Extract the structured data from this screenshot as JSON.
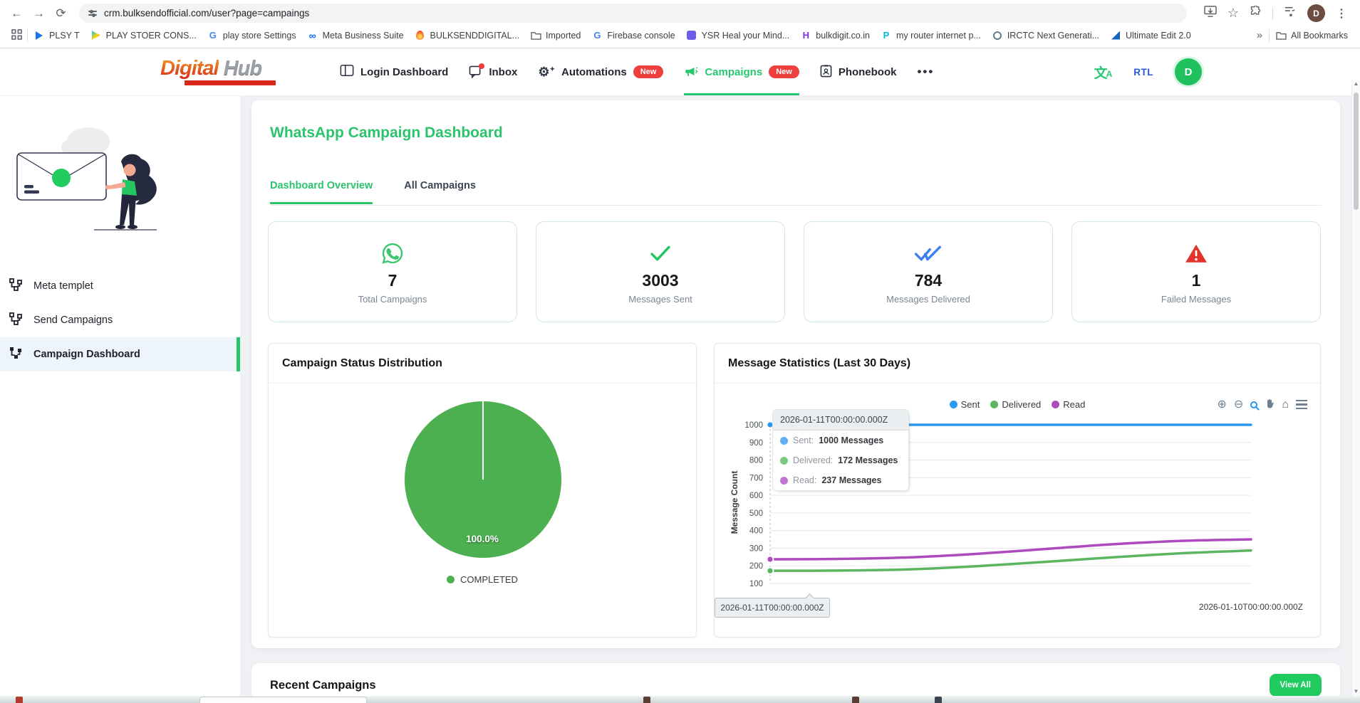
{
  "browser": {
    "url": "crm.bulksendofficial.com/user?page=campaings",
    "profile_initial": "D",
    "bookmarks": [
      {
        "label": "PLSY T",
        "icon": "play-blue"
      },
      {
        "label": "PLAY STOER CONS...",
        "icon": "play-color"
      },
      {
        "label": "play store Settings",
        "icon": "google-g"
      },
      {
        "label": "Meta Business Suite",
        "icon": "meta-infinity"
      },
      {
        "label": "BULKSENDDIGITAL...",
        "icon": "orange-flame"
      },
      {
        "label": "Imported",
        "icon": "folder"
      },
      {
        "label": "Firebase console",
        "icon": "google-g"
      },
      {
        "label": "YSR Heal your Mind...",
        "icon": "purple-app"
      },
      {
        "label": "bulkdigit.co.in",
        "icon": "purple-h"
      },
      {
        "label": "my router internet p...",
        "icon": "teal-p"
      },
      {
        "label": "IRCTC Next Generati...",
        "icon": "irctc-logo"
      },
      {
        "label": "Ultimate Edit 2.0",
        "icon": "blue-sail"
      }
    ],
    "overflow_chevron": "»",
    "all_bookmarks": "All Bookmarks"
  },
  "header": {
    "logo": {
      "word1": "Digital",
      "word2": "Hub"
    },
    "nav": [
      {
        "label": "Login Dashboard"
      },
      {
        "label": "Inbox"
      },
      {
        "label": "Automations",
        "badge": "New"
      },
      {
        "label": "Campaigns",
        "badge": "New"
      },
      {
        "label": "Phonebook"
      }
    ],
    "rtl_label": "RTL",
    "avatar_initial": "D",
    "accent_color": "#28c76f",
    "badge_color": "#ee3e3e"
  },
  "sidebar": {
    "items": [
      {
        "label": "Meta templet"
      },
      {
        "label": "Send Campaigns"
      },
      {
        "label": "Campaign Dashboard"
      }
    ]
  },
  "main": {
    "title": "WhatsApp Campaign Dashboard",
    "tabs": [
      {
        "label": "Dashboard Overview"
      },
      {
        "label": "All Campaigns"
      }
    ],
    "stats": [
      {
        "value": "7",
        "label": "Total Campaigns",
        "icon": "whatsapp",
        "color": "#38c76c"
      },
      {
        "value": "3003",
        "label": "Messages Sent",
        "icon": "check",
        "color": "#22c55e"
      },
      {
        "value": "784",
        "label": "Messages Delivered",
        "icon": "double-check",
        "color": "#3d7ff0"
      },
      {
        "value": "1",
        "label": "Failed Messages",
        "icon": "warning",
        "color": "#e2342c"
      }
    ],
    "recent": {
      "title": "Recent Campaigns",
      "view_all": "View All"
    }
  },
  "chart_data": [
    {
      "type": "pie",
      "title": "Campaign Status Distribution",
      "categories": [
        "COMPLETED"
      ],
      "values": [
        100.0
      ],
      "data_label": "100.0%",
      "colors": [
        "#4caf50"
      ],
      "legend_position": "bottom"
    },
    {
      "type": "line",
      "title": "Message Statistics (Last 30 Days)",
      "ylabel": "Message Count",
      "ylim": [
        100,
        1000
      ],
      "yticks": [
        100,
        200,
        300,
        400,
        500,
        600,
        700,
        800,
        900,
        1000
      ],
      "grid": true,
      "legend_position": "top",
      "x_axis_labels": [
        "2026-01-11T00:00:00.000Z",
        "2026-01-10T00:00:00.000Z"
      ],
      "x": [
        0,
        0.14,
        0.29,
        0.43,
        0.57,
        0.71,
        0.86,
        1
      ],
      "series": [
        {
          "name": "Sent",
          "color": "#2b98f0",
          "values": [
            1000,
            1000,
            1000,
            1000,
            1000,
            1000,
            1000,
            1000
          ]
        },
        {
          "name": "Delivered",
          "color": "#5cb660",
          "values": [
            172,
            173,
            180,
            198,
            222,
            248,
            272,
            287
          ]
        },
        {
          "name": "Read",
          "color": "#ad4bbe",
          "values": [
            237,
            239,
            248,
            268,
            295,
            322,
            342,
            350
          ]
        }
      ],
      "tooltip": {
        "header": "2026-01-11T00:00:00.000Z",
        "rows": [
          {
            "label": "Sent:",
            "value": "1000 Messages",
            "color": "#61aef3"
          },
          {
            "label": "Delivered:",
            "value": "172 Messages",
            "color": "#7ec981"
          },
          {
            "label": "Read:",
            "value": "237 Messages",
            "color": "#c173d1"
          }
        ]
      }
    }
  ]
}
